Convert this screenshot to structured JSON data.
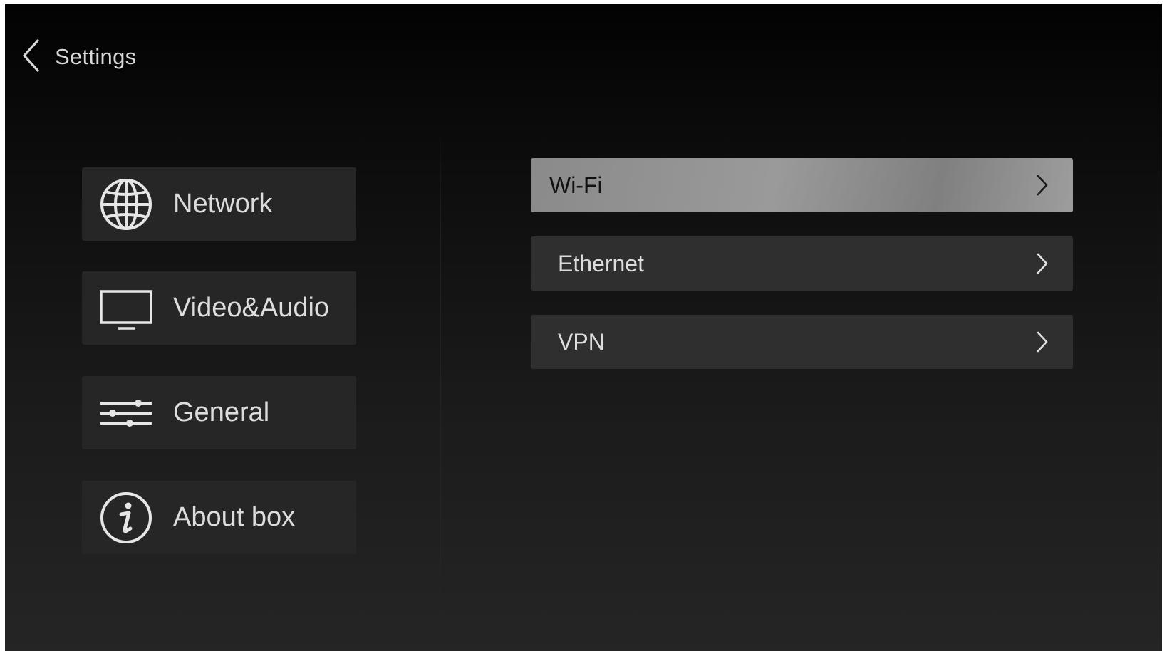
{
  "header": {
    "back_icon": "chevron-left-icon",
    "title": "Settings"
  },
  "sidebar": {
    "items": [
      {
        "label": "Network",
        "icon": "globe-icon",
        "selected": true
      },
      {
        "label": "Video&Audio",
        "icon": "monitor-icon",
        "selected": false
      },
      {
        "label": "General",
        "icon": "sliders-icon",
        "selected": false
      },
      {
        "label": "About box",
        "icon": "info-icon",
        "selected": false
      }
    ]
  },
  "detail": {
    "items": [
      {
        "label": "Wi-Fi",
        "icon": "chevron-right-icon",
        "selected": true
      },
      {
        "label": "Ethernet",
        "icon": "chevron-right-icon",
        "selected": false
      },
      {
        "label": "VPN",
        "icon": "chevron-right-icon",
        "selected": false
      }
    ]
  },
  "colors": {
    "selected_row": "#9a9a9a",
    "row_background": "#2f2f2f",
    "sidebar_background": "#262626",
    "text": "#dddddd"
  }
}
